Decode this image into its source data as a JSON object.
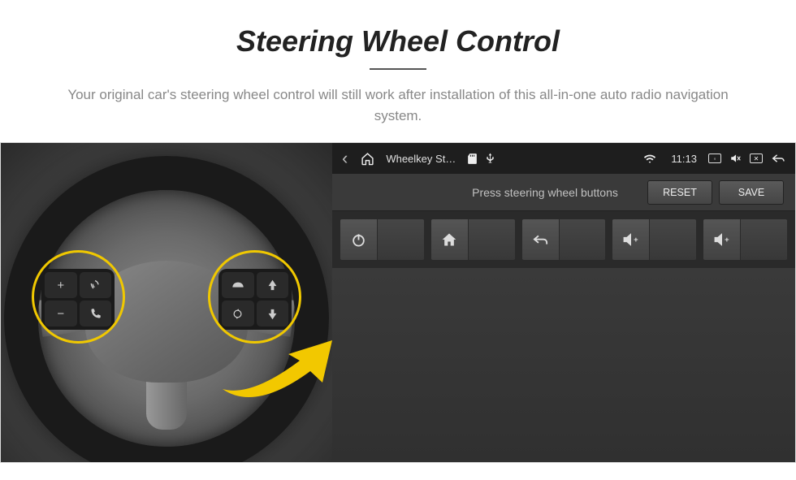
{
  "header": {
    "title": "Steering Wheel Control",
    "subtitle": "Your original car's steering wheel control will still work after installation of this all-in-one auto radio navigation system."
  },
  "wheel": {
    "left_buttons": [
      "+",
      "voice",
      "−",
      "phone"
    ],
    "right_buttons": [
      "media",
      "nav-up",
      "cycle",
      "nav-down"
    ]
  },
  "status_bar": {
    "app_title": "Wheelkey St…",
    "time": "11:13"
  },
  "instruction": {
    "text": "Press steering wheel buttons",
    "reset": "RESET",
    "save": "SAVE"
  },
  "grid": {
    "items": [
      "power",
      "home",
      "back",
      "volume-up",
      "volume-up-2"
    ]
  }
}
